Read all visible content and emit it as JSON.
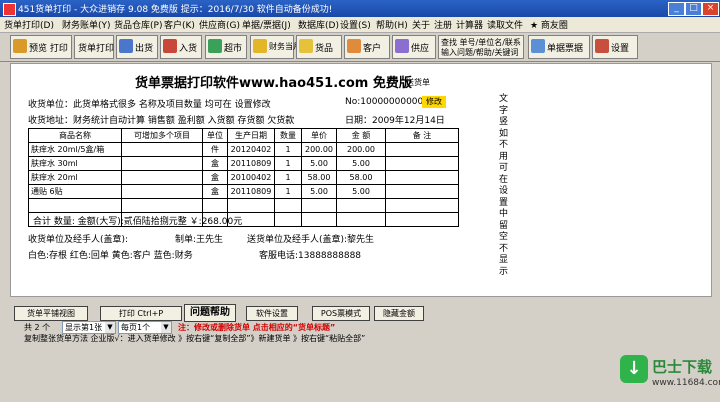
{
  "window": {
    "title": "451货单打印 - 大众进销存 9.08 免费版   提示：2016/7/30 软件自动备份成功!"
  },
  "menu": [
    "货单打印(D)",
    "财务账单(Y)",
    "货品仓库(P)",
    "客户(K)",
    "供应商(G)",
    "单据/票据(J)",
    "数据库(D)",
    "设置(S)",
    "帮助(H)",
    "关于",
    "注册",
    "计算器",
    "读取文件",
    "★ 商友圈"
  ],
  "toolbar": {
    "preview": "预览 打印",
    "print_order": "货单打印",
    "out": "出货",
    "in": "入货",
    "supermarket": "超市",
    "finance": "财务当月",
    "goods": "货品",
    "customer": "客户",
    "supply": "供应",
    "search_line1": "查找 单号/单位名/联系",
    "search_line2": "输入问题/帮助/关键词",
    "bills": "单据票据",
    "settings": "设置"
  },
  "doc": {
    "title": "货单票据打印软件www.hao451.com 免费版",
    "subtitle": "送货单",
    "receiver": "收货单位：此货单格式很多 名称及项目数量 均可在 设置修改",
    "number": "No:1000000000002",
    "modify": "修改",
    "address": "收货地址：财务统计自动计算 销售额 盈利额 入货额 存货额 欠货款",
    "date": "日期：2009年12月14日",
    "side_text": "文字 竖 如 不用 可在设置中留空不显示",
    "headers": [
      "商品名称",
      "可增加多个项目",
      "单位",
      "生产日期",
      "数量",
      "单价",
      "金 额",
      "备 注"
    ],
    "rows": [
      [
        "肤痒水 20ml/5盒/箱",
        "",
        "件",
        "20120402",
        "1",
        "200.00",
        "200.00",
        ""
      ],
      [
        "肤痒水 30ml",
        "",
        "盒",
        "20110809",
        "1",
        "5.00",
        "5.00",
        ""
      ],
      [
        "肤痒水 20ml",
        "",
        "盒",
        "20100402",
        "1",
        "58.00",
        "58.00",
        ""
      ],
      [
        "通贴 6贴",
        "",
        "盒",
        "20110809",
        "1",
        "5.00",
        "5.00",
        ""
      ],
      [
        "",
        "",
        "",
        "",
        "",
        "",
        "",
        ""
      ],
      [
        "",
        "",
        "",
        "",
        "",
        "",
        "",
        ""
      ]
    ],
    "total": "合计  数量:      金额(大写):贰佰陆拾捌元整      ￥:268.00元",
    "sig1": "收货单位及经手人(盖章):",
    "maker": "制单:王先生",
    "sig2": "送货单位及经手人(盖章):黎先生",
    "colors": "白色:存根   红色:回单   黄色:客户   蓝色:财务",
    "phone": "客服电话:13888888888"
  },
  "bottom": {
    "view_btn": "货单平铺视图",
    "print_btn": "打印 Ctrl+P",
    "help_btn": "问题帮助",
    "settings_btn": "软件设置",
    "pos_btn": "POS票模式",
    "hide_btn": "隐藏金额",
    "count": "共 2 个",
    "show_select": "显示第1张",
    "page_select": "每页1个",
    "notice": "注：修改或删除货单  点击相应的“货单标题”",
    "help_line": "复制整张货单方法 企业版√：进入货单修改 》按右键“复制全部”》新建货单 》按右键“粘贴全部”"
  },
  "watermark": {
    "icon": "download-logo-icon",
    "name": "巴士下载",
    "url": "www.11684.com"
  }
}
